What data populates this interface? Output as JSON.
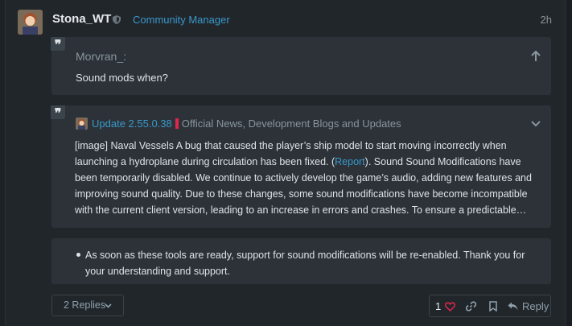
{
  "post": {
    "author": "Stona_WT",
    "role": "Community Manager",
    "time": "2h"
  },
  "quote1": {
    "username": "Morvran_:",
    "text": "Sound mods when?"
  },
  "quote2": {
    "topic_title": "Update 2.55.0.38",
    "category": "Official News, Development Blogs and Updates",
    "category_color": "#e0264b",
    "body_before_link": "[image] Naval Vessels A bug that caused the player’s ship model to start moving incorrectly when launching a hydroplane during circulation has been fixed. (",
    "link_text": "Report",
    "body_after_link": "). Sound Sound Modifications have been temporarily disabled. We continue to actively develop the game’s audio, adding new features and improving sound quality. Due to these changes, some sound modifications have become incompatible with the current client version, leading to an increase in errors and crashes. To ensure a predictable…"
  },
  "quote3": {
    "bullet": "As soon as these tools are ready, support for sound modifications will be re-enabled. Thank you for your understanding and support."
  },
  "footer": {
    "replies_label": "2 Replies",
    "like_count": "1",
    "reply_label": "Reply"
  },
  "icons": {
    "quote_mark": "❞",
    "shield": "shield-icon",
    "arrow_up": "arrow-up-icon",
    "chevron_down": "chevron-down-icon",
    "heart": "heart-icon",
    "link": "link-icon",
    "bookmark": "bookmark-icon",
    "reply": "reply-icon"
  },
  "colors": {
    "accent": "#3a98c9",
    "heart": "#e0264b"
  }
}
